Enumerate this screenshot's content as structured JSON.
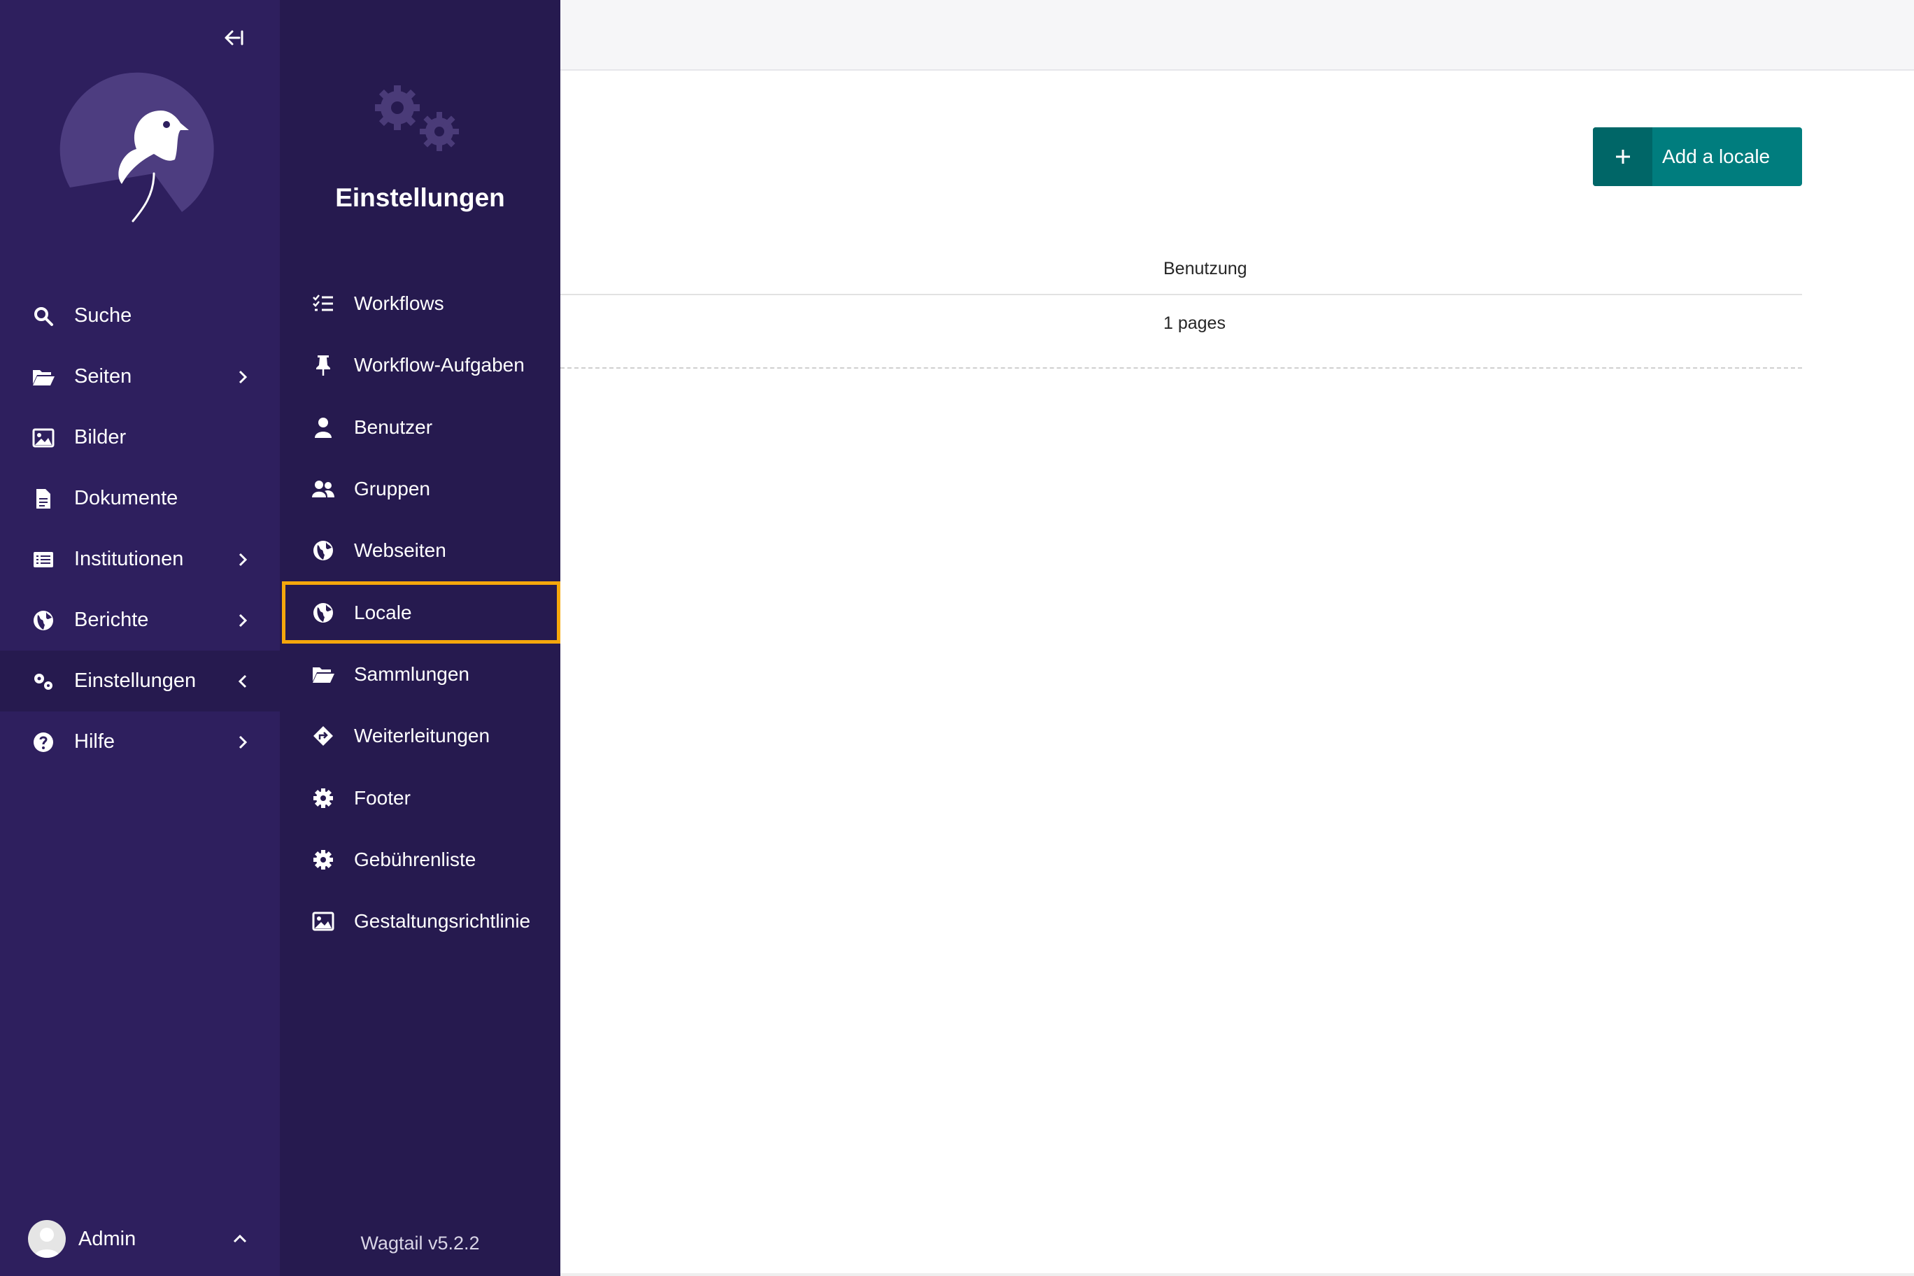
{
  "sidebar": {
    "collapse_label": "Toggle sidebar",
    "items": [
      {
        "label": "Suche",
        "icon": "search-icon"
      },
      {
        "label": "Seiten",
        "icon": "folder-open-icon",
        "has_submenu": true
      },
      {
        "label": "Bilder",
        "icon": "image-icon"
      },
      {
        "label": "Dokumente",
        "icon": "document-icon"
      },
      {
        "label": "Institutionen",
        "icon": "list-icon",
        "has_submenu": true
      },
      {
        "label": "Berichte",
        "icon": "globe-icon",
        "has_submenu": true
      },
      {
        "label": "Einstellungen",
        "icon": "cogs-icon",
        "has_submenu": true,
        "active": true
      },
      {
        "label": "Hilfe",
        "icon": "help-icon",
        "has_submenu": true
      }
    ],
    "account": {
      "label": "Admin"
    }
  },
  "submenu": {
    "title": "Einstellungen",
    "items": [
      {
        "label": "Workflows",
        "icon": "tasks-icon"
      },
      {
        "label": "Workflow-Aufgaben",
        "icon": "thumbtack-icon"
      },
      {
        "label": "Benutzer",
        "icon": "user-icon"
      },
      {
        "label": "Gruppen",
        "icon": "group-icon"
      },
      {
        "label": "Webseiten",
        "icon": "globe-icon"
      },
      {
        "label": "Locale",
        "icon": "globe-icon",
        "highlighted": true
      },
      {
        "label": "Sammlungen",
        "icon": "folder-open-icon"
      },
      {
        "label": "Weiterleitungen",
        "icon": "redirect-icon"
      },
      {
        "label": "Footer",
        "icon": "cog-icon"
      },
      {
        "label": "Gebührenliste",
        "icon": "cog-icon"
      },
      {
        "label": "Gestaltungsrichtlinie",
        "icon": "image-icon"
      }
    ],
    "version": "Wagtail v5.2.2"
  },
  "main": {
    "add_button_label": "Add a locale",
    "table": {
      "headers": {
        "usage": "Benutzung"
      },
      "rows": [
        {
          "usage": "1 pages"
        }
      ]
    }
  },
  "colors": {
    "sidebar_bg": "#2e1f5e",
    "submenu_bg": "#261a4f",
    "accent_teal": "#007d7e",
    "highlight_outline": "#f5a70c"
  }
}
